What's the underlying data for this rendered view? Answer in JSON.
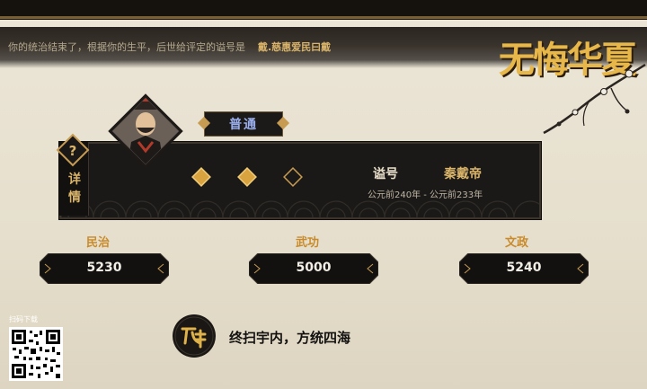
{
  "epitaph": {
    "text": "你的统治结束了，根据你的生平，后世给评定的谥号是",
    "name": "戴.慈惠爱民曰戴"
  },
  "logo": {
    "text": "无悔华夏"
  },
  "detail": {
    "label": "详情"
  },
  "ruler": {
    "difficulty": "普通",
    "title_label": "谥号",
    "title_value": "秦戴帝",
    "reign": "公元前240年 - 公元前233年",
    "rating_filled": 2,
    "rating_total": 3
  },
  "stats": [
    {
      "label": "民治",
      "value": "5230"
    },
    {
      "label": "武功",
      "value": "5000"
    },
    {
      "label": "文政",
      "value": "5240"
    }
  ],
  "qr": {
    "label": "扫码下载"
  },
  "motto": "终扫宇内，方统四海",
  "colors": {
    "gold": "#d9b46a",
    "panel": "#1b1917",
    "stat_label": "#c98a2a",
    "badge_text": "#9bb0ee"
  }
}
